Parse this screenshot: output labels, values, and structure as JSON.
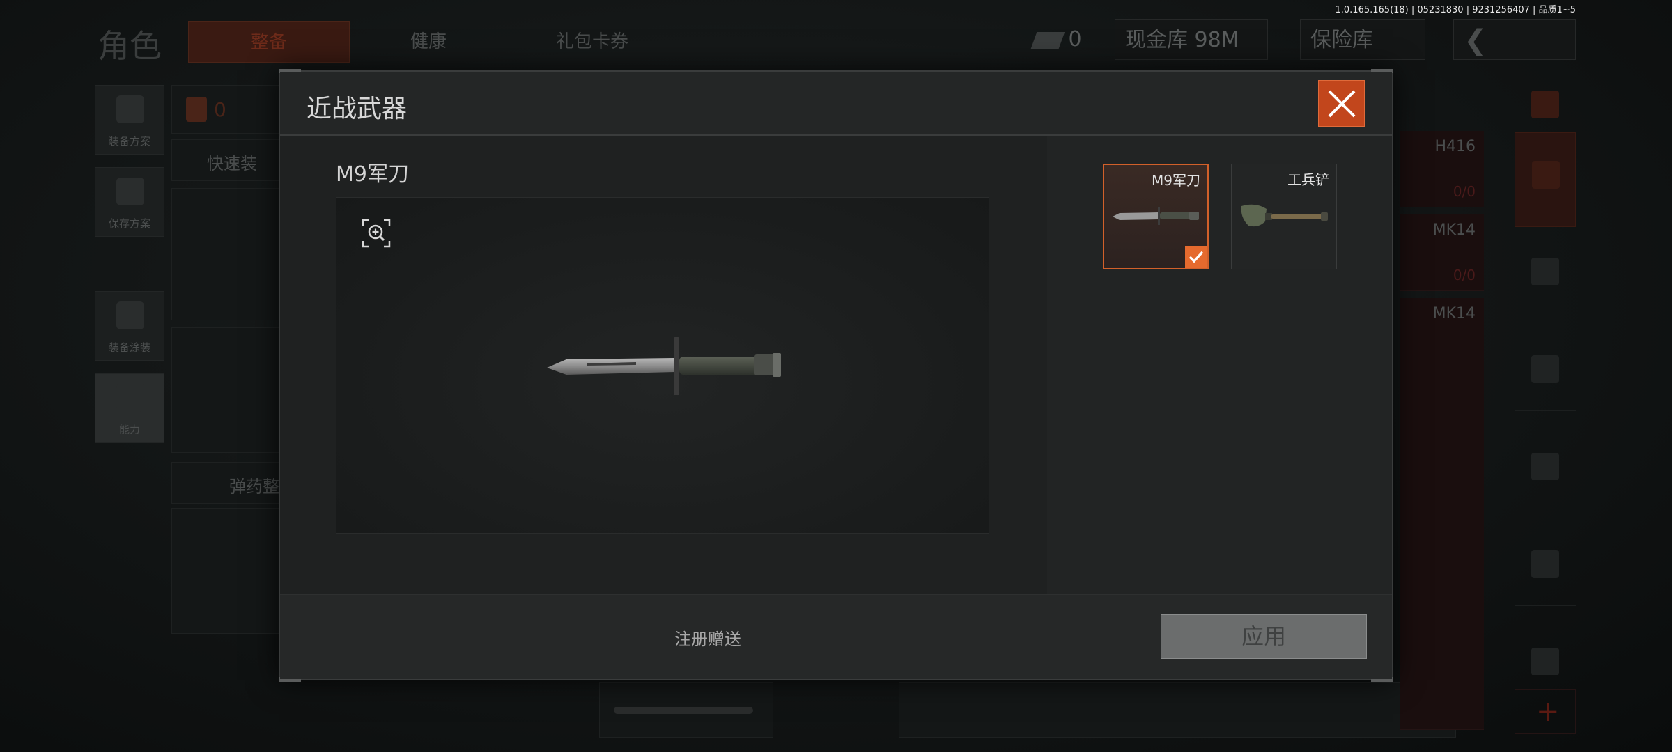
{
  "version_text": "1.0.165.165(18) | 05231830 | 9231256407 | 品质1~5",
  "background": {
    "section_title": "角色",
    "tabs": [
      {
        "label": "整备",
        "active": true
      },
      {
        "label": "健康",
        "active": false
      },
      {
        "label": "礼包卡券",
        "active": false
      }
    ],
    "currency_count": "0",
    "cash_vault": "现金库 98M",
    "safe_box": "保险库",
    "side_cards": [
      "装备方案",
      "保存方案",
      "装备涂装",
      "能力"
    ],
    "loadout_count": "0",
    "quick_equip": "快速装",
    "ammo_label": "弹药整",
    "weapon_list": [
      {
        "name": "H416",
        "count": "0/0"
      },
      {
        "name": "MK14",
        "count": "0/0"
      },
      {
        "name": "MK14",
        "count": ""
      }
    ]
  },
  "modal": {
    "title": "近战武器",
    "item_name": "M9军刀",
    "options": [
      {
        "label": "M9军刀",
        "selected": true,
        "icon": "bayonet-icon"
      },
      {
        "label": "工兵铲",
        "selected": false,
        "icon": "shovel-icon"
      }
    ],
    "source_text": "注册赠送",
    "apply_label": "应用"
  },
  "colors": {
    "accent": "#e56a2e",
    "close_bg": "#c2461c"
  }
}
